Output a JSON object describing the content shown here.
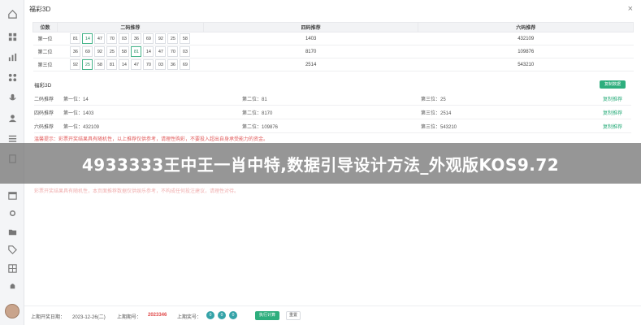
{
  "app": {
    "title": "福彩3D",
    "close_glyph": "×"
  },
  "sidebar": {
    "icons": [
      "home-icon",
      "grid-icon",
      "chart-icon",
      "apps-icon",
      "mic-icon",
      "user-icon",
      "list-icon",
      "doc-icon",
      "calendar-icon",
      "settings-icon",
      "folder-icon",
      "tag-icon",
      "table-icon",
      "bell-icon",
      "menu-icon"
    ]
  },
  "top_table": {
    "headers": [
      "位数",
      "二码推荐",
      "四码推荐",
      "六码推荐"
    ],
    "rows": [
      {
        "label": "第一位",
        "nums": [
          "81",
          "14",
          "47",
          "70",
          "03",
          "36",
          "69",
          "92",
          "25",
          "58"
        ],
        "hl": [
          1
        ],
        "four": "1403",
        "six": "432109"
      },
      {
        "label": "第二位",
        "nums": [
          "36",
          "69",
          "92",
          "25",
          "58",
          "81",
          "14",
          "47",
          "70",
          "03"
        ],
        "hl": [
          5
        ],
        "four": "8170",
        "six": "109876"
      },
      {
        "label": "第三位",
        "nums": [
          "92",
          "25",
          "58",
          "81",
          "14",
          "47",
          "70",
          "03",
          "36",
          "69"
        ],
        "hl": [
          1
        ],
        "four": "2514",
        "six": "543210"
      }
    ]
  },
  "panel": {
    "title": "福彩3D",
    "button": "复制数据",
    "rows": [
      {
        "cat": "二码推荐",
        "p1": "第一位：14",
        "p2": "第二位：81",
        "p3": "第三位：25",
        "link": "复制推荐"
      },
      {
        "cat": "四码推荐",
        "p1": "第一位：1403",
        "p2": "第二位：8170",
        "p3": "第三位：2514",
        "link": "复制推荐"
      },
      {
        "cat": "六码推荐",
        "p1": "第一位：432109",
        "p2": "第二位：109876",
        "p3": "第三位：543210",
        "link": "复制推荐"
      }
    ],
    "warning": "温馨提示：彩票开奖结果具有随机性，以上推荐仅供参考，请理性购彩，不要投入超出自身承受能力的资金。",
    "warning2": "彩票开奖结果具有随机性，本页面推荐数据仅供娱乐参考，不构成任何投注建议，请理性对待。"
  },
  "banner": {
    "text": "4933333王中王一肖中特,数据引导设计方法_外观版KOS9.72"
  },
  "footer": {
    "open_date_label": "上期开奖日期：",
    "open_date": "2023-12-26(二)",
    "issue_label": "上期期号：",
    "issue": "2023346",
    "number_label": "上期奖号：",
    "balls": [
      "0",
      "0",
      "0"
    ],
    "exec_button": "执行计算",
    "reset_button": "重置"
  },
  "colors": {
    "accent": "#2eae7d",
    "warning": "#e15b5b",
    "ball": "#35a3a8",
    "issue": "#e04848"
  }
}
